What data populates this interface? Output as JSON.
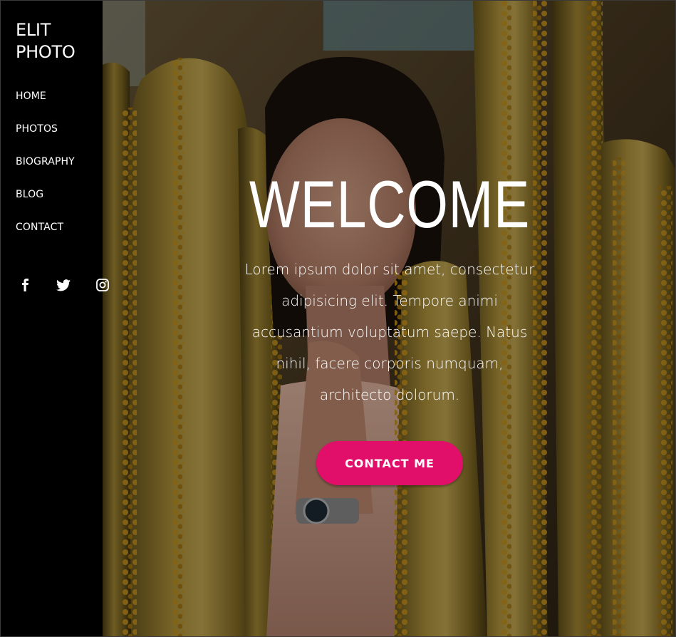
{
  "sidebar": {
    "brand": "ELIT\nPHOTO",
    "nav": [
      {
        "label": "HOME"
      },
      {
        "label": "PHOTOS"
      },
      {
        "label": "BIOGRAPHY"
      },
      {
        "label": "BLOG"
      },
      {
        "label": "CONTACT"
      }
    ],
    "social": [
      {
        "icon": "facebook-icon"
      },
      {
        "icon": "twitter-icon"
      },
      {
        "icon": "instagram-icon"
      }
    ]
  },
  "hero": {
    "title": "WELCOME",
    "body": "Lorem ipsum dolor sit amet, consectetur adipisicing elit. Tempore animi accusantium voluptatum saepe. Natus nihil, facere corporis numquam, architecto dolorum.",
    "cta_label": "CONTACT ME"
  },
  "colors": {
    "sidebar_bg": "#000000",
    "accent": "#e20f6a",
    "text": "#ffffff"
  }
}
